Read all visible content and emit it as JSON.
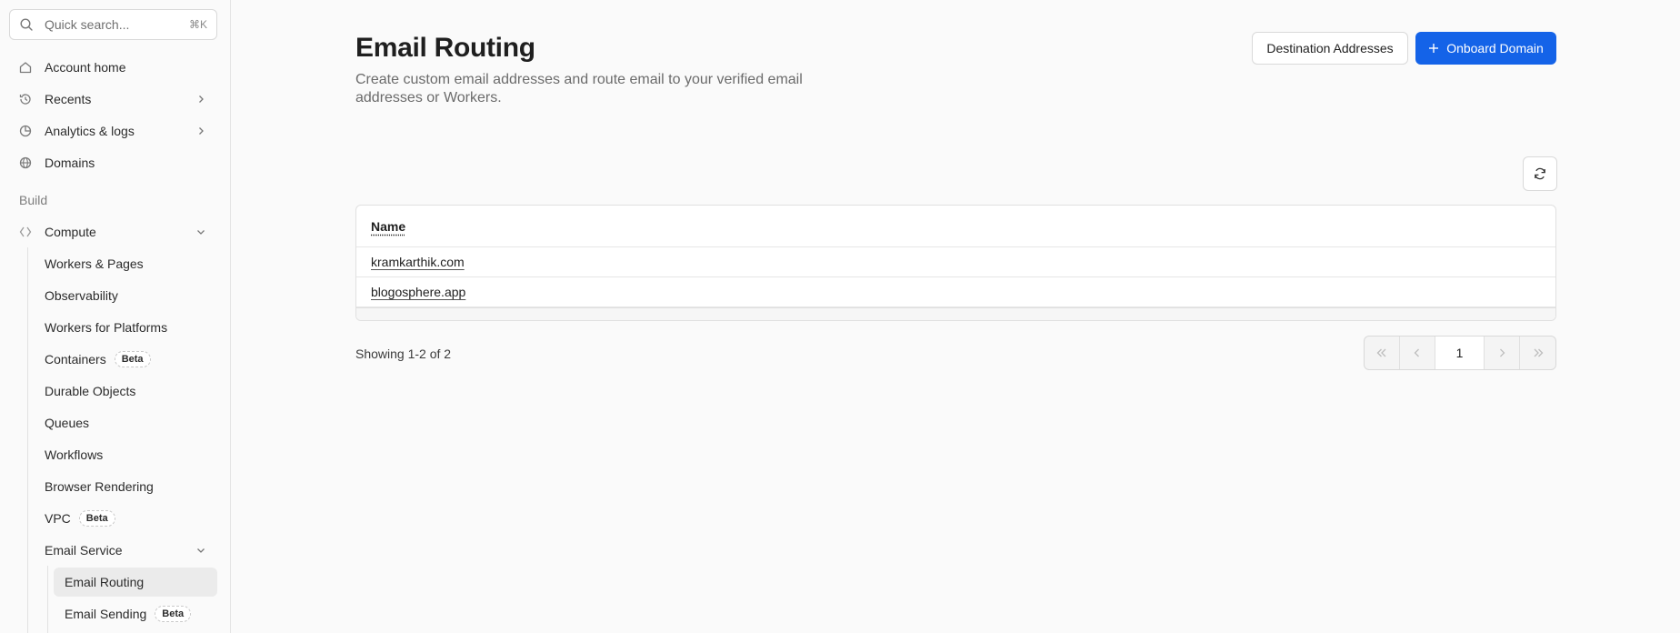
{
  "sidebar": {
    "search": {
      "placeholder": "Quick search...",
      "shortcut": "⌘K"
    },
    "items": [
      {
        "label": "Account home",
        "icon": "home-icon"
      },
      {
        "label": "Recents",
        "icon": "history-icon"
      },
      {
        "label": "Analytics & logs",
        "icon": "chart-icon"
      },
      {
        "label": "Domains",
        "icon": "globe-icon"
      }
    ],
    "section_build": "Build",
    "compute": {
      "label": "Compute",
      "icon": "compute-icon"
    },
    "compute_items": [
      {
        "label": "Workers & Pages"
      },
      {
        "label": "Observability"
      },
      {
        "label": "Workers for Platforms"
      },
      {
        "label": "Containers",
        "badge": "Beta"
      },
      {
        "label": "Durable Objects"
      },
      {
        "label": "Queues"
      },
      {
        "label": "Workflows"
      },
      {
        "label": "Browser Rendering"
      },
      {
        "label": "VPC",
        "badge": "Beta"
      },
      {
        "label": "Email Service"
      }
    ],
    "email_items": [
      {
        "label": "Email Routing"
      },
      {
        "label": "Email Sending",
        "badge": "Beta"
      }
    ]
  },
  "main": {
    "title": "Email Routing",
    "subtitle": "Create custom email addresses and route email to your verified email addresses or Workers.",
    "btn_destination": "Destination Addresses",
    "btn_onboard": "Onboard Domain",
    "table": {
      "header": "Name",
      "rows": [
        "kramkarthik.com",
        "blogosphere.app"
      ]
    },
    "showing": "Showing 1-2 of 2",
    "page": "1"
  },
  "colors": {
    "primary": "#1463e8",
    "active_bg": "#ebebeb"
  }
}
